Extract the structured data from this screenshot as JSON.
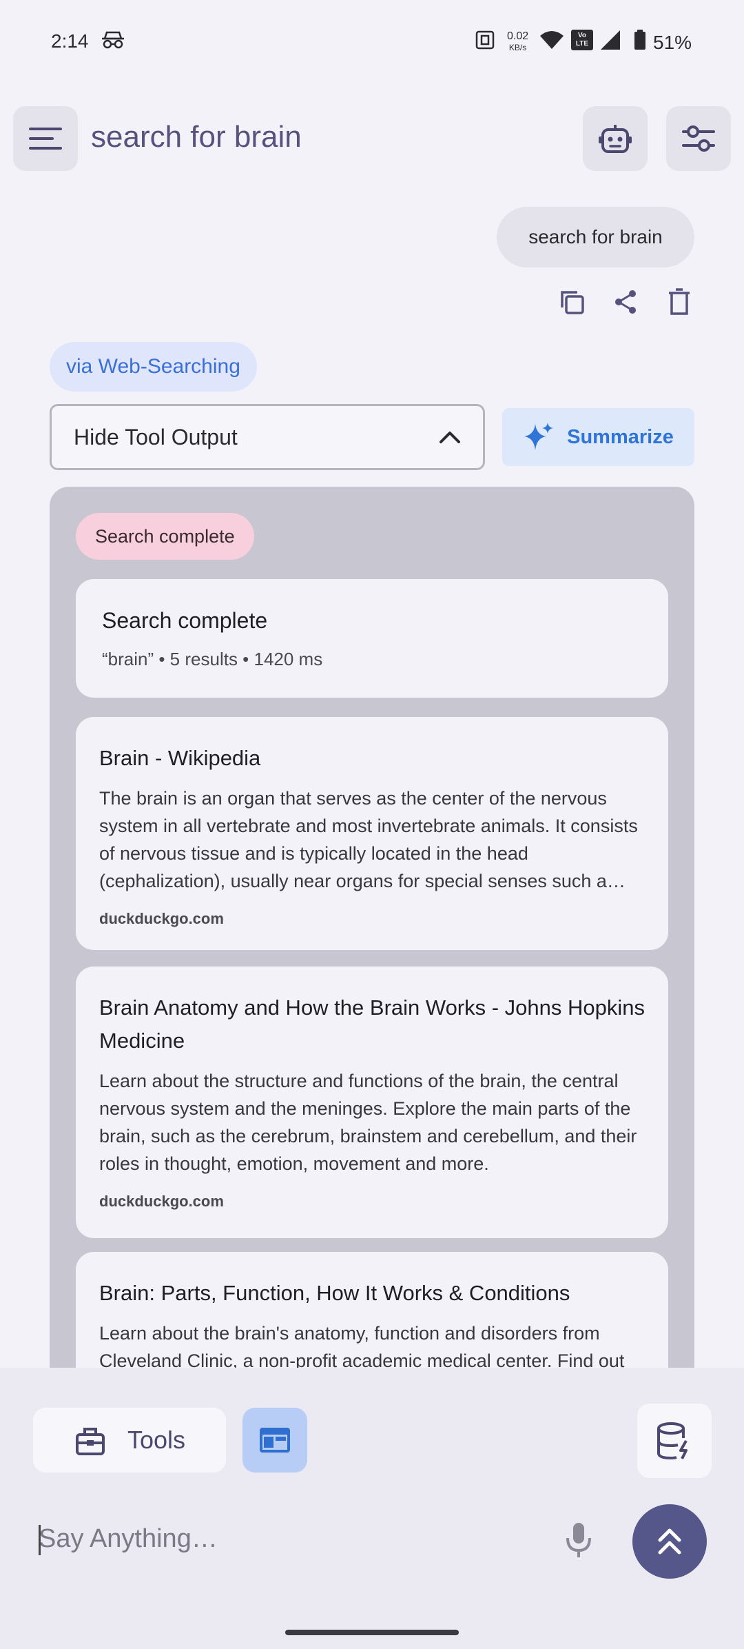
{
  "status_bar": {
    "time": "2:14",
    "net_speed_value": "0.02",
    "net_speed_unit": "KB/s",
    "volte": "Vo LTE",
    "battery": "51%"
  },
  "top_bar": {
    "title": "search for brain"
  },
  "conversation": {
    "user_message": "search for brain",
    "via_label": "via Web-Searching",
    "tool_toggle_label": "Hide Tool Output",
    "summarize_label": "Summarize"
  },
  "tool_output": {
    "status_chip": "Search complete",
    "summary_title": "Search complete",
    "summary_meta": "“brain” • 5 results • 1420 ms",
    "results": [
      {
        "title": "Brain - Wikipedia",
        "snippet": "The brain is an organ that serves as the center of the nervous system in all vertebrate and most invertebrate animals. It consists of nervous tissue and is typically located in the head (cephalization), usually near organs for special senses such a…",
        "source": "duckduckgo.com"
      },
      {
        "title": "Brain Anatomy and How the Brain Works - Johns Hopkins Medicine",
        "snippet": "Learn about the structure and functions of the brain, the central nervous system and the meninges. Explore the main parts of the brain, such as the cerebrum, brainstem and cerebellum, and their roles in thought, emotion, movement and more.",
        "source": "duckduckgo.com"
      },
      {
        "title": "Brain: Parts, Function, How It Works & Conditions",
        "snippet": "Learn about the brain's anatomy, function and disorders from Cleveland Clinic, a non-profit academic medical center. Find out",
        "source": ""
      }
    ]
  },
  "composer": {
    "tools_label": "Tools",
    "placeholder": "Say Anything…"
  },
  "colors": {
    "accent": "#55578a",
    "link_blue": "#2f74d6",
    "chip_pink": "#f7cfdd",
    "panel_bg": "#c8c7d1"
  }
}
